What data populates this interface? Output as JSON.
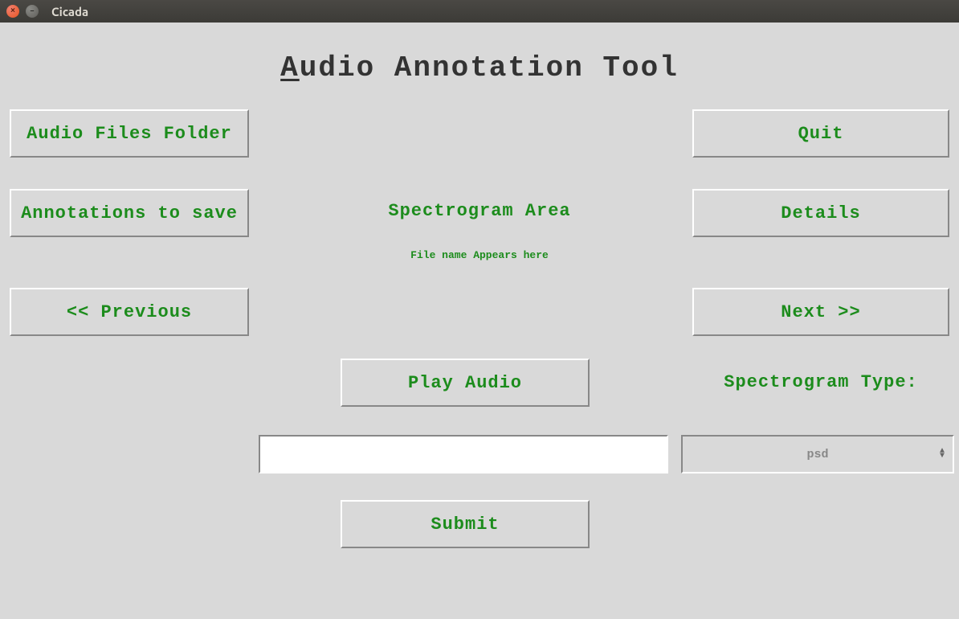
{
  "window": {
    "title": "Cicada"
  },
  "header": {
    "title_prefix_underlined_char": "A",
    "title_rest": "udio Annotation Tool"
  },
  "buttons": {
    "audio_files_folder": "Audio Files Folder",
    "annotations_to_save": "Annotations to save",
    "previous": "<< Previous",
    "quit": "Quit",
    "details": "Details",
    "next": "Next >>",
    "play_audio": "Play Audio",
    "submit": "Submit"
  },
  "labels": {
    "spectrogram_area": "Spectrogram Area",
    "file_name_appears": "File name Appears here",
    "spectrogram_type": "Spectrogram Type:"
  },
  "inputs": {
    "annotation_value": ""
  },
  "select": {
    "spectrogram_type_value": "psd"
  }
}
